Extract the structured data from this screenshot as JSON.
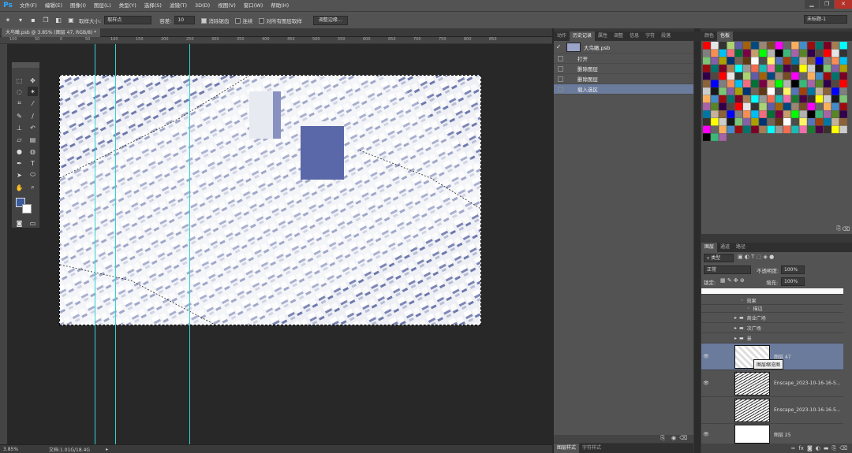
{
  "menubar": {
    "logo": "Ps",
    "items": [
      "文件(F)",
      "编辑(E)",
      "图像(I)",
      "图层(L)",
      "类型(Y)",
      "选择(S)",
      "滤镜(T)",
      "3D(D)",
      "视图(V)",
      "窗口(W)",
      "帮助(H)"
    ],
    "win_min": "▁",
    "win_max": "❐",
    "win_close": "✕"
  },
  "options": {
    "sample_size_label": "取样大小:",
    "sample_size_value": "取样点",
    "tolerance_label": "容差:",
    "tolerance_value": "10",
    "antialias_label": "消除锯齿",
    "contiguous_label": "连续",
    "all_layers_label": "对所有图层取样",
    "refine_edge_button": "调整边缘...",
    "workspace": "未标题-1"
  },
  "document": {
    "tab_label": "大鸟瞰.psb @ 3.85% (图层 47, RGB/8) *",
    "ruler_top_ticks": [
      "100",
      "50",
      "0",
      "50",
      "100",
      "150",
      "200",
      "250",
      "300",
      "350",
      "400",
      "450",
      "500",
      "550",
      "600",
      "650",
      "700",
      "750",
      "800",
      "850"
    ],
    "status_zoom": "3.85%",
    "status_doc": "文档:1.01G/18.4G"
  },
  "history": {
    "tabs": [
      "动作",
      "历史记录",
      "属性",
      "调整",
      "信息",
      "字符",
      "段落"
    ],
    "snapshot": "大鸟瞰.psb",
    "items": [
      "打开",
      "删除图层",
      "删除图层",
      "载入选区"
    ],
    "bottom_tabs": [
      "图层样式",
      "字符样式"
    ]
  },
  "swatches": {
    "tabs": [
      "颜色",
      "色板"
    ]
  },
  "layers": {
    "tabs": [
      "图层",
      "通道",
      "路径"
    ],
    "filter_kind": "类型",
    "blend_mode": "正常",
    "opacity_label": "不透明度:",
    "opacity_value": "100%",
    "lock_label": "锁定:",
    "fill_label": "填充:",
    "fill_value": "100%",
    "effects_label": "效果",
    "stroke_label": "描边",
    "groups": [
      "商业广场",
      "次广场",
      "景"
    ],
    "layer_rows": [
      {
        "name": "图层 47",
        "visible": true
      },
      {
        "name": "Enscape_2023-10-16-16-5...",
        "visible": true
      },
      {
        "name": "Enscape_2023-10-16-16-5...",
        "visible": false
      },
      {
        "name": "图层 25",
        "visible": true
      }
    ],
    "tooltip": "图层缩览图"
  },
  "colors": {
    "accent": "#31a8ff",
    "foreground": "#3b5b9c",
    "background": "#ffffff",
    "guide": "#2ed3d3",
    "selected_row": "#6a7b9c"
  }
}
